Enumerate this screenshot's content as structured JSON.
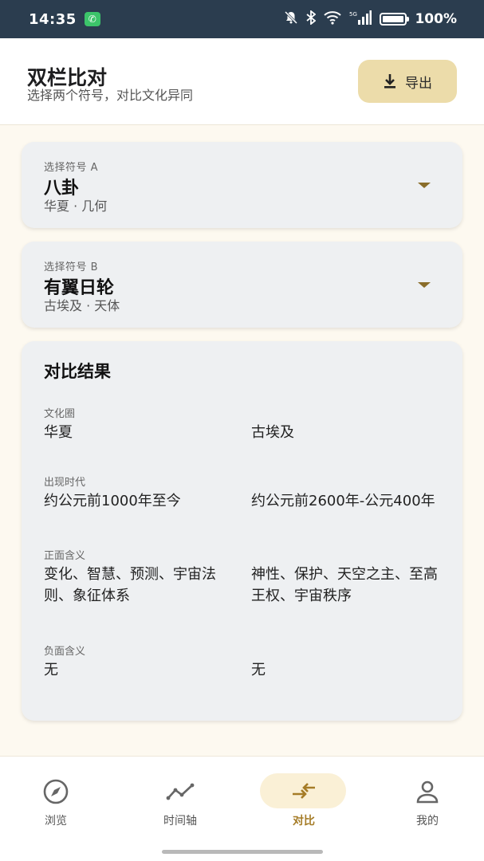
{
  "status_bar": {
    "time": "14:35",
    "network": "5G",
    "battery_level": 1.0,
    "battery_text": "100%"
  },
  "header": {
    "title": "双栏比对",
    "subtitle": "选择两个符号，对比文化异同",
    "export_label": "导出"
  },
  "symbol_a": {
    "label": "选择符号 A",
    "name": "八卦",
    "meta": "华夏 · 几何"
  },
  "symbol_b": {
    "label": "选择符号 B",
    "name": "有翼日轮",
    "meta": "古埃及 · 天体"
  },
  "result": {
    "title": "对比结果",
    "rows": [
      {
        "label": "文化圈",
        "a": "华夏",
        "b": "古埃及"
      },
      {
        "label": "出现时代",
        "a": "约公元前1000年至今",
        "b": "约公元前2600年-公元400年"
      },
      {
        "label": "正面含义",
        "a": "变化、智慧、预测、宇宙法则、象征体系",
        "b": "神性、保护、天空之主、至高王权、宇宙秩序"
      },
      {
        "label": "负面含义",
        "a": "无",
        "b": "无"
      }
    ]
  },
  "bottom_nav": {
    "items": [
      {
        "label": "浏览",
        "icon": "compass-icon"
      },
      {
        "label": "时间轴",
        "icon": "timeline-icon"
      },
      {
        "label": "对比",
        "icon": "compare-arrows-icon"
      },
      {
        "label": "我的",
        "icon": "person-icon"
      }
    ],
    "active_index": 2
  },
  "colors": {
    "accent": "#a57c27",
    "export_button_bg": "#ecdcaa",
    "status_bar_bg": "#2b3d4f",
    "page_bg": "#fdf9f0",
    "card_bg": "#eef0f2"
  }
}
